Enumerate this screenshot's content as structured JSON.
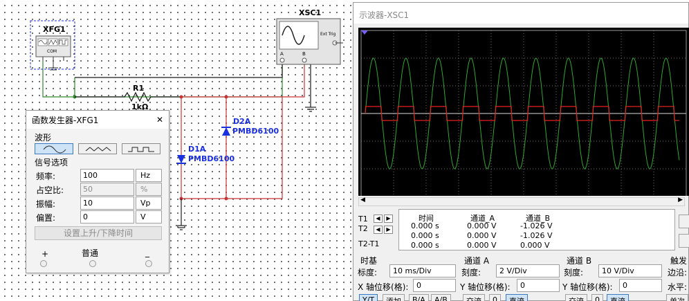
{
  "schematic": {
    "xfg_label": "XFG1",
    "xfg_com": "COM",
    "xsc_label": "XSC1",
    "xsc_ext_trig": "Ext Trig",
    "xsc_a": "A",
    "xsc_b": "B",
    "r1_name": "R1",
    "r1_value": "1kΩ",
    "d2_name": "D2A",
    "d2_part": "PMBD6100",
    "d1_name": "D1A",
    "d1_part": "PMBD6100"
  },
  "function_generator": {
    "title": "函数发生器-XFG1",
    "close_glyph": "✕",
    "waveform_section": "波形",
    "signal_section": "信号选项",
    "rows": [
      {
        "label": "频率:",
        "value": "100",
        "unit": "Hz"
      },
      {
        "label": "占空比:",
        "value": "50",
        "unit": "%"
      },
      {
        "label": "振幅:",
        "value": "10",
        "unit": "Vp"
      },
      {
        "label": "偏置:",
        "value": "0",
        "unit": "V"
      }
    ],
    "rise_fall_button": "设置上升/下降时间",
    "plus": "+",
    "common": "普通",
    "minus": "_"
  },
  "oscilloscope": {
    "title": "示波器-XSC1",
    "readout": {
      "col_time": "时间",
      "col_a": "通道_A",
      "col_b": "通道_B",
      "t1": "T1",
      "t2": "T2",
      "t2t1": "T2-T1",
      "row1": {
        "time": "0.000 s",
        "a": "0.000 V",
        "b": "-1.026 V"
      },
      "row2": {
        "time": "0.000 s",
        "a": "0.000 V",
        "b": "-1.026 V"
      },
      "row3": {
        "time": "0.000 s",
        "a": "0.000 V",
        "b": "0.000 V"
      }
    },
    "timebase": {
      "title": "时基",
      "scale_label": "标度:",
      "scale": "10 ms/Div",
      "xpos_label": "X 轴位移(格):",
      "xpos": "0"
    },
    "channel_a": {
      "title": "通道 A",
      "scale_label": "刻度:",
      "scale": "2  V/Div",
      "ypos_label": "Y 轴位移(格):",
      "ypos": "0"
    },
    "channel_b": {
      "title": "通道 B",
      "scale_label": "刻度:",
      "scale": "10  V/Div",
      "ypos_label": "Y 轴位移(格):",
      "ypos": "0"
    },
    "trigger": {
      "title": "触发",
      "edge_label": "边沿:",
      "level_label": "水平:"
    },
    "bottom_tabs": [
      "Y/T",
      "添加",
      "B/A",
      "A/B",
      "交流",
      "0",
      "直流",
      "交流",
      "0",
      "直流",
      "单次"
    ],
    "colors": {
      "channel_a": "#2fa82f",
      "channel_b": "#e02020",
      "grid": "#9a9a9a",
      "screen": "#000000"
    }
  }
}
